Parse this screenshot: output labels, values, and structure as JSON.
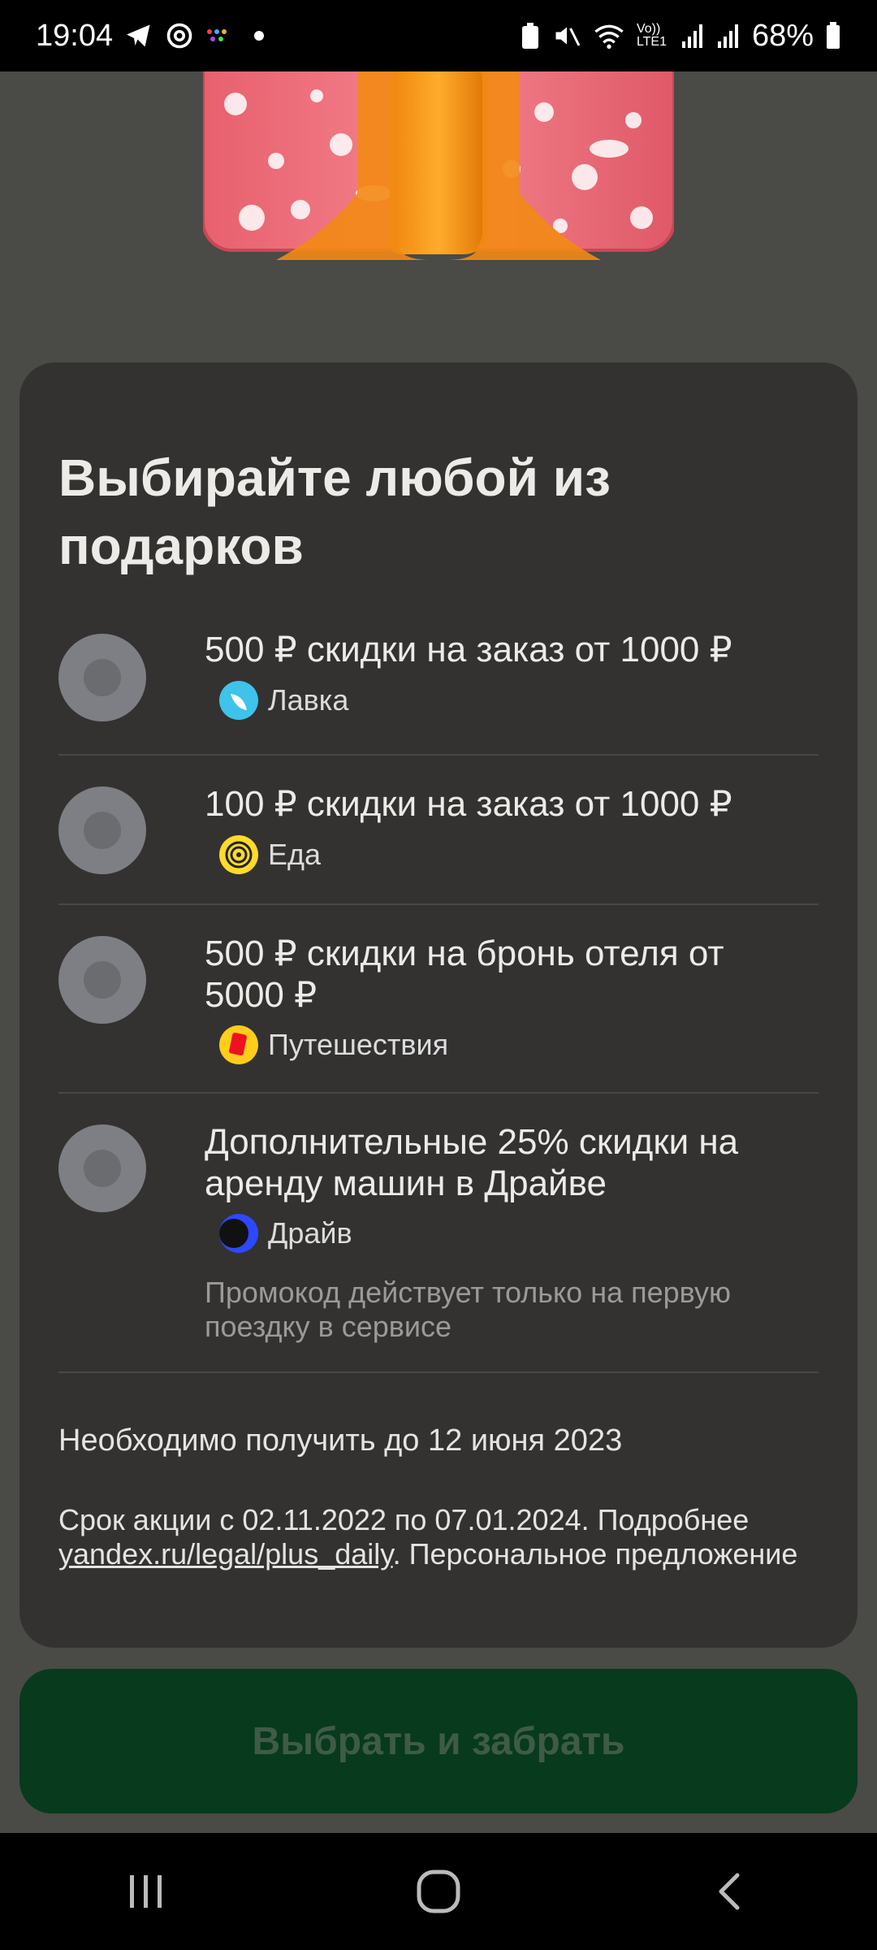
{
  "status_bar": {
    "time": "19:04",
    "battery": "68%",
    "network": "Vo)) LTE1"
  },
  "card": {
    "title": "Выбирайте любой из подарков",
    "options": [
      {
        "text": "500 ₽ скидки на заказ от 1000 ₽",
        "service": "Лавка",
        "icon": "lavka-icon",
        "icon_color": "#3fc3ea"
      },
      {
        "text": "100 ₽ скидки на заказ от 1000 ₽",
        "service": "Еда",
        "icon": "eda-icon",
        "icon_color": "#ffdb29"
      },
      {
        "text": "500 ₽ скидки на бронь отеля от 5000 ₽",
        "service": "Путешествия",
        "icon": "travel-icon",
        "icon_color": "#ffcd1a"
      },
      {
        "text": "Дополнительные 25% скидки на аренду машин в Драйве",
        "service": "Драйв",
        "icon": "drive-icon",
        "icon_color": "#2e48ff",
        "note": "Промокод действует только на первую поездку в сервисе"
      }
    ],
    "deadline": "Необходимо получить до 12 июня 2023",
    "terms_prefix": "Срок акции с 02.11.2022 по 07.01.2024. Подробнее ",
    "terms_link": "yandex.ru/legal/plus_daily",
    "terms_suffix": ". Персональное предложение"
  },
  "action_button": {
    "label": "Выбрать и забрать"
  },
  "colors": {
    "background": "#4a4a46",
    "card": "#333231",
    "button": "#083a1d",
    "button_text": "#3f5b48"
  }
}
